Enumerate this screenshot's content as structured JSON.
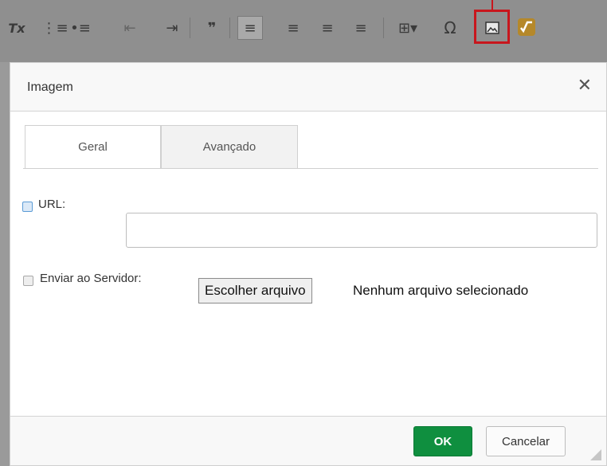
{
  "toolbar": {
    "remove_format_label": "Tx",
    "numbered_list_label": "⋮≡",
    "bulleted_list_label": "•≡",
    "outdent_label": "⇤",
    "indent_label": "⇥",
    "blockquote_label": "❞",
    "align_left_label": "≡",
    "align_center_label": "≡",
    "align_right_label": "≡",
    "justify_label": "≡",
    "table_label": "⊞▾",
    "special_char_label": "Ω"
  },
  "dialog": {
    "title": "Imagem",
    "close_label": "✕",
    "tabs": [
      {
        "label": "Geral"
      },
      {
        "label": "Avançado"
      }
    ],
    "url_label": "URL:",
    "url_value": "",
    "upload_label": "Enviar ao Servidor:",
    "file_button_label": "Escolher arquivo",
    "file_status": "Nenhum arquivo selecionado",
    "ok_label": "OK",
    "cancel_label": "Cancelar"
  },
  "colors": {
    "highlight": "#c8161d",
    "ok": "#0f8f3f",
    "overlay": "#8c8c8c"
  }
}
